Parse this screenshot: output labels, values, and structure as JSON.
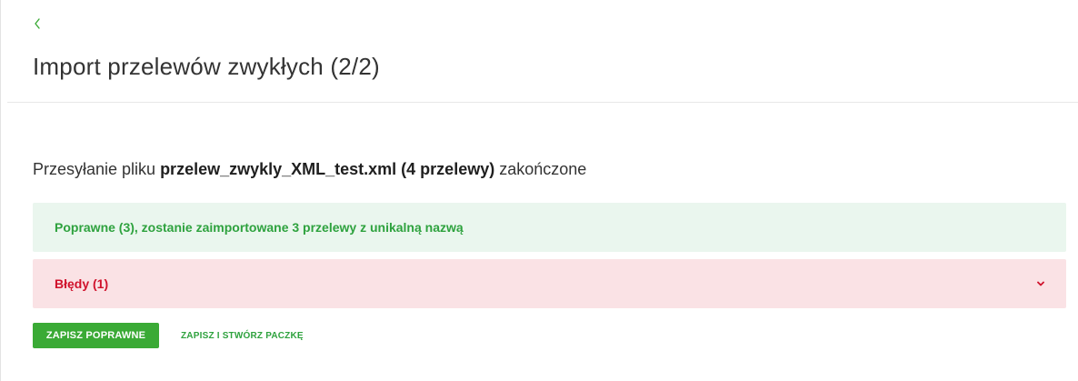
{
  "header": {
    "back_icon": "chevron-left-icon",
    "title": "Import przelewów zwykłych (2/2)"
  },
  "upload": {
    "prefix": "Przesyłanie pliku ",
    "filename_and_count": "przelew_zwykly_XML_test.xml (4 przelewy)",
    "suffix": " zakończone"
  },
  "alerts": {
    "success_text": "Poprawne (3), zostanie zaimportowane 3 przelewy z unikalną nazwą",
    "error_text": "Błędy (1)",
    "error_toggle_icon": "chevron-down-icon"
  },
  "actions": {
    "save_valid_label": "ZAPISZ POPRAWNE",
    "save_and_bundle_label": "ZAPISZ I STWÓRZ PACZKĘ"
  },
  "colors": {
    "accent": "#3aaa35",
    "success_text": "#2ea23e",
    "success_bg": "#eaf6ee",
    "error_text": "#d0122c",
    "error_bg": "#fae2e5"
  }
}
